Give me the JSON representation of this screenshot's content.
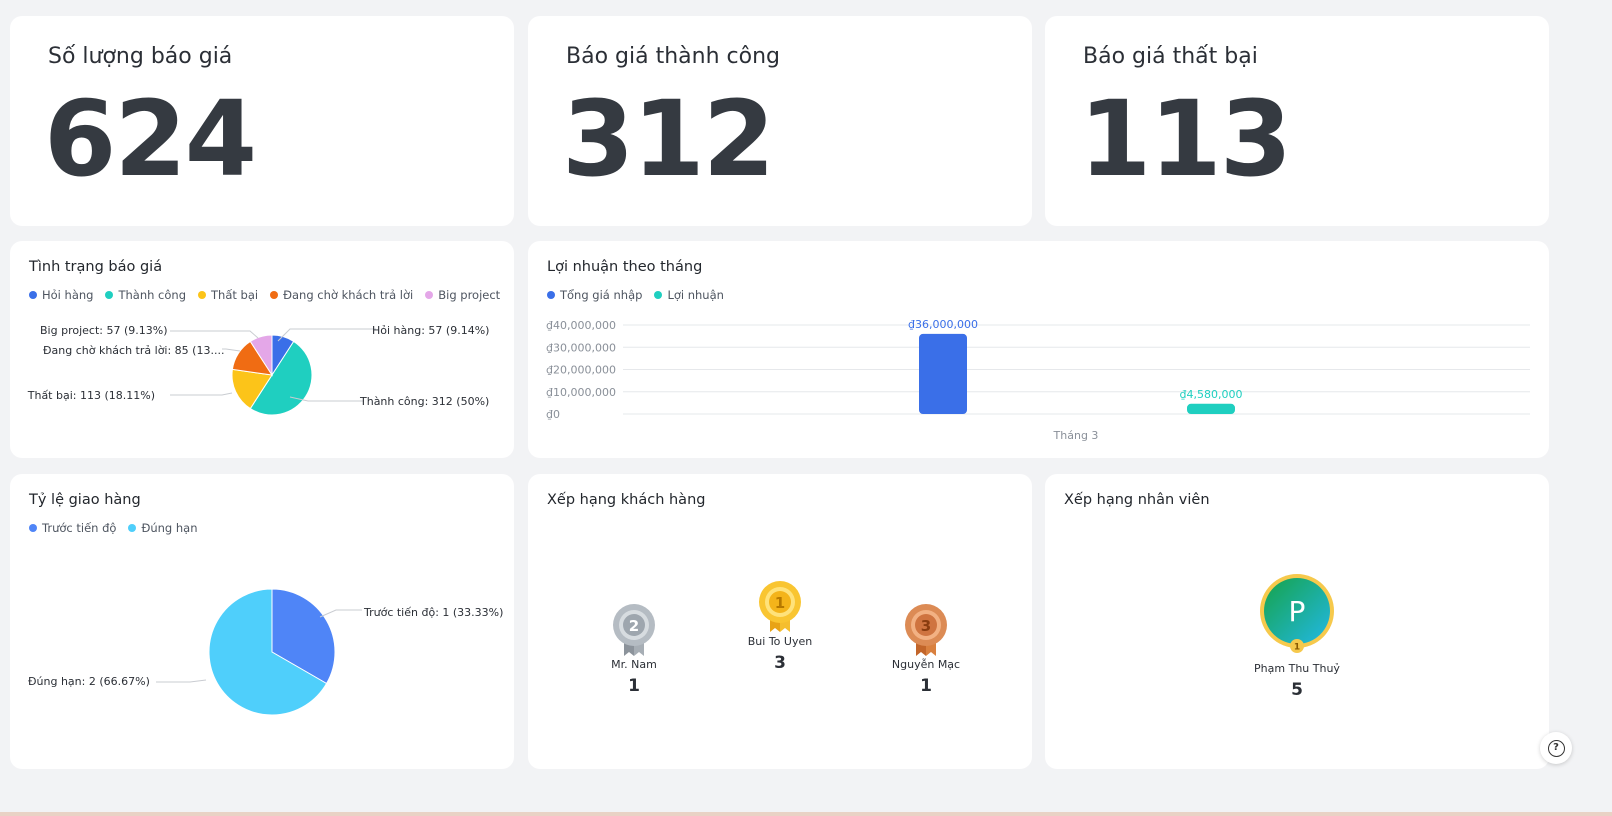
{
  "kpis": [
    {
      "title": "Số lượng báo giá",
      "value": "624"
    },
    {
      "title": "Báo giá thành công",
      "value": "312"
    },
    {
      "title": "Báo giá thất bại",
      "value": "113"
    }
  ],
  "status_chart": {
    "title": "Tình trạng báo giá",
    "legend": [
      {
        "name": "Hỏi hàng",
        "color": "#3a6fe8"
      },
      {
        "name": "Thành công",
        "color": "#1fcfc0"
      },
      {
        "name": "Thất bại",
        "color": "#fcc419"
      },
      {
        "name": "Đang chờ khách trả lời",
        "color": "#f06c13"
      },
      {
        "name": "Big project",
        "color": "#e4a7e8"
      }
    ],
    "labels": {
      "hoi_hang": "Hỏi hàng: 57 (9.14%)",
      "thanh_cong": "Thành công: 312 (50%)",
      "that_bai": "Thất bại: 113 (18.11%)",
      "dang_cho": "Đang chờ khách trả lời: 85 (13....",
      "big_project": "Big project: 57 (9.13%)"
    }
  },
  "profit_chart": {
    "title": "Lợi nhuận theo tháng",
    "legend": [
      {
        "name": "Tổng giá nhập",
        "color": "#3a6fe8"
      },
      {
        "name": "Lợi nhuận",
        "color": "#1fcfc0"
      }
    ],
    "y_ticks": [
      "₫40,000,000",
      "₫30,000,000",
      "₫20,000,000",
      "₫10,000,000",
      "₫0"
    ],
    "x_label": "Tháng 3",
    "bar_labels": [
      "₫36,000,000",
      "₫4,580,000"
    ]
  },
  "delivery_chart": {
    "title": "Tỷ lệ giao hàng",
    "legend": [
      {
        "name": "Trước tiến độ",
        "color": "#4f85f7"
      },
      {
        "name": "Đúng hạn",
        "color": "#4fcffb"
      }
    ],
    "labels": {
      "truoc": "Trước tiến độ: 1 (33.33%)",
      "dung": "Đúng hạn: 2 (66.67%)"
    }
  },
  "customer_rank": {
    "title": "Xếp hạng khách hàng",
    "entries": [
      {
        "rank": "2",
        "name": "Mr. Nam",
        "value": "1"
      },
      {
        "rank": "1",
        "name": "Bui To Uyen",
        "value": "3"
      },
      {
        "rank": "3",
        "name": "Nguyễn Mạc",
        "value": "1"
      }
    ]
  },
  "employee_rank": {
    "title": "Xếp hạng nhân viên",
    "avatar_letter": "P",
    "badge": "1",
    "name": "Phạm Thu Thuỷ",
    "value": "5"
  },
  "help_label": "?",
  "chart_data": [
    {
      "type": "pie",
      "title": "Tình trạng báo giá",
      "categories": [
        "Hỏi hàng",
        "Thành công",
        "Thất bại",
        "Đang chờ khách trả lời",
        "Big project"
      ],
      "values": [
        57,
        312,
        113,
        85,
        57
      ],
      "percent": [
        9.14,
        50,
        18.11,
        13.62,
        9.13
      ],
      "colors": [
        "#3a6fe8",
        "#1fcfc0",
        "#fcc419",
        "#f06c13",
        "#e4a7e8"
      ],
      "legend": "top-left"
    },
    {
      "type": "bar",
      "title": "Lợi nhuận theo tháng",
      "categories": [
        "Tháng 3"
      ],
      "series": [
        {
          "name": "Tổng giá nhập",
          "values": [
            36000000
          ],
          "color": "#3a6fe8"
        },
        {
          "name": "Lợi nhuận",
          "values": [
            4580000
          ],
          "color": "#1fcfc0"
        }
      ],
      "ylim": [
        0,
        40000000
      ],
      "grid": true,
      "legend": "top-left"
    },
    {
      "type": "pie",
      "title": "Tỷ lệ giao hàng",
      "categories": [
        "Trước tiến độ",
        "Đúng hạn"
      ],
      "values": [
        1,
        2
      ],
      "percent": [
        33.33,
        66.67
      ],
      "colors": [
        "#4f85f7",
        "#4fcffb"
      ],
      "legend": "top-left"
    }
  ]
}
